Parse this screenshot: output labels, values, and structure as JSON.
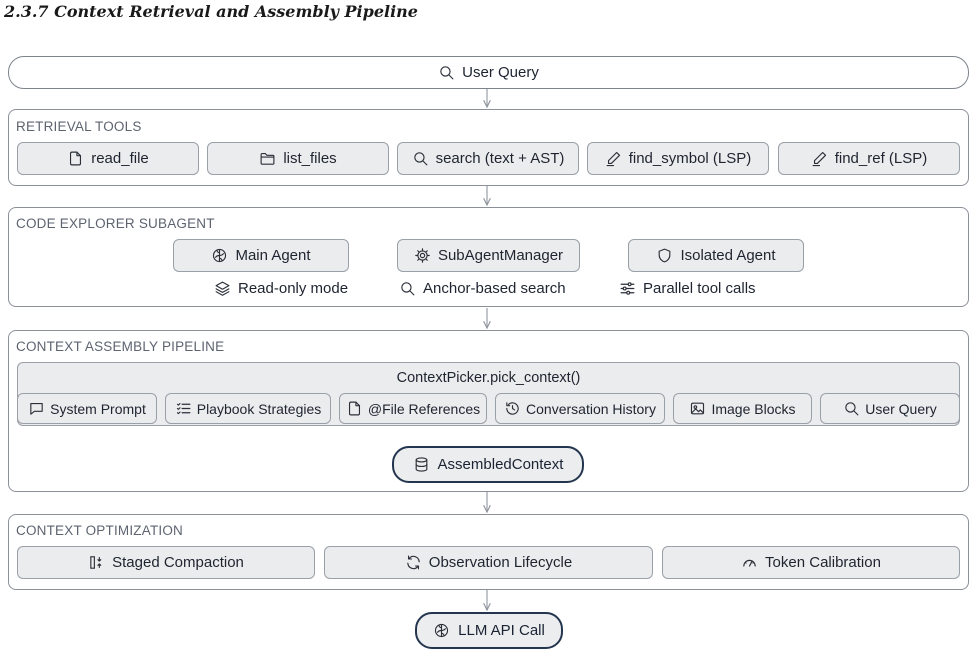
{
  "heading": "2.3.7   Context Retrieval and Assembly Pipeline",
  "user_query": "User Query",
  "retrieval": {
    "title": "RETRIEVAL TOOLS",
    "tools": [
      "read_file",
      "list_files",
      "search (text + AST)",
      "find_symbol (LSP)",
      "find_ref (LSP)"
    ]
  },
  "explorer": {
    "title": "CODE EXPLORER SUBAGENT",
    "main_agent": "Main Agent",
    "manager": "SubAgentManager",
    "isolated": "Isolated Agent",
    "features": [
      "Read-only mode",
      "Anchor-based search",
      "Parallel tool calls"
    ]
  },
  "assembly": {
    "title": "CONTEXT ASSEMBLY PIPELINE",
    "picker": "ContextPicker.pick_context()",
    "sources": [
      "System Prompt",
      "Playbook Strategies",
      "@File References",
      "Conversation History",
      "Image Blocks",
      "User Query"
    ],
    "assembled": "AssembledContext"
  },
  "optimization": {
    "title": "CONTEXT OPTIMIZATION",
    "items": [
      "Staged Compaction",
      "Observation Lifecycle",
      "Token Calibration"
    ]
  },
  "llm_call": "LLM API Call",
  "colors": {
    "accent_border": "#24364f",
    "chip_fill": "#ebeced",
    "panel_border": "#8c9199",
    "wire": "#9aa0a8"
  }
}
